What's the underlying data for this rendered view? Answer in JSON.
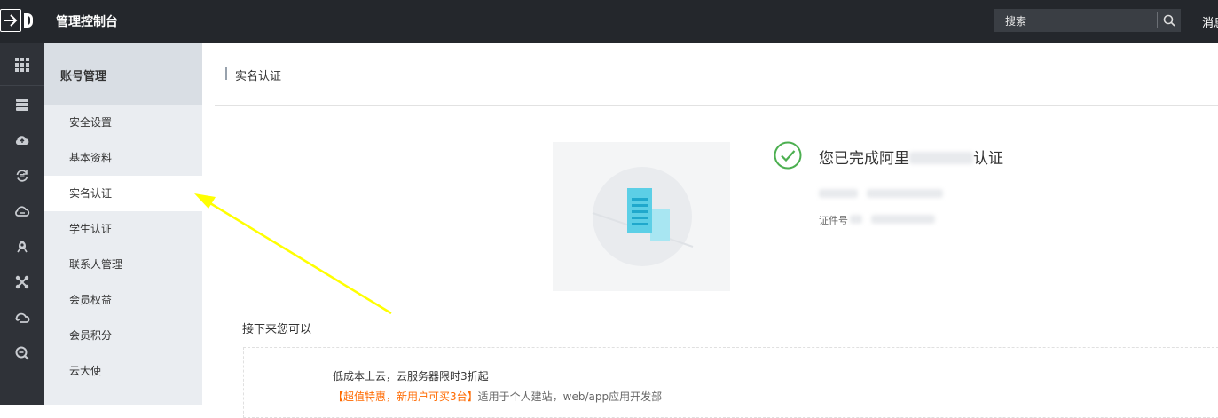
{
  "header": {
    "title": "管理控制台",
    "search_placeholder": "搜索",
    "messages_label": "消息"
  },
  "rail": {
    "icons": [
      "apps-grid-icon",
      "database-icon",
      "cloud-upload-icon",
      "sync-icon",
      "cloud-icon",
      "rocket-icon",
      "network-icon",
      "cloud-arrow-icon",
      "search-zoom-icon"
    ]
  },
  "sidebar": {
    "heading": "账号管理",
    "items": [
      {
        "label": "安全设置"
      },
      {
        "label": "基本资料"
      },
      {
        "label": "实名认证",
        "active": true
      },
      {
        "label": "学生认证"
      },
      {
        "label": "联系人管理"
      },
      {
        "label": "会员权益"
      },
      {
        "label": "会员积分"
      },
      {
        "label": "云大使"
      }
    ]
  },
  "main": {
    "page_title": "实名认证",
    "status": {
      "text_prefix": "您已完成阿里",
      "text_suffix": "认证",
      "cert_label": "证件号"
    },
    "next": {
      "heading": "接下来您可以",
      "card_line1": "低成本上云，云服务器限时3折起",
      "card_highlight": "【超值特惠，新用户可买3台】",
      "card_rest": "适用于个人建站，web/app应用开发部"
    }
  },
  "colors": {
    "topbar": "#24272c",
    "rail": "#2f3238",
    "sidebar": "#eaedf1",
    "success": "#4caf50",
    "accent_orange": "#ff6a00",
    "annotation_arrow": "#ffff00"
  }
}
